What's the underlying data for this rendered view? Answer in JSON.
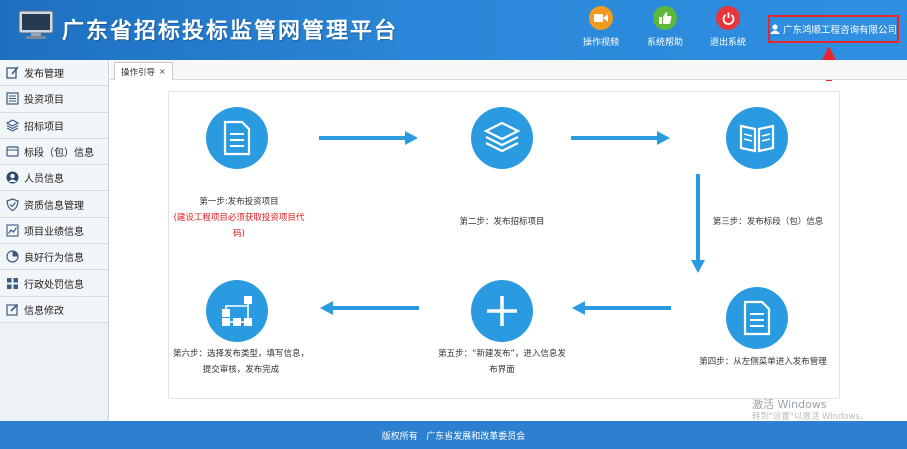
{
  "header": {
    "title": "广东省招标投标监管网管理平台",
    "buttons": [
      {
        "label": "操作视频",
        "icon": "video-icon",
        "color": "#f29a1e"
      },
      {
        "label": "系统帮助",
        "icon": "thumbs-up-icon",
        "color": "#5cb83a"
      },
      {
        "label": "退出系统",
        "icon": "power-icon",
        "color": "#e8353a"
      }
    ],
    "user": "广东鸿顺工程咨询有限公司"
  },
  "sidebar": {
    "items": [
      {
        "label": "发布管理",
        "icon": "edit-icon"
      },
      {
        "label": "投资项目",
        "icon": "list-icon"
      },
      {
        "label": "招标项目",
        "icon": "layers-icon"
      },
      {
        "label": "标段（包）信息",
        "icon": "card-icon"
      },
      {
        "label": "人员信息",
        "icon": "user-icon"
      },
      {
        "label": "资质信息管理",
        "icon": "shield-icon"
      },
      {
        "label": "项目业绩信息",
        "icon": "chart-icon"
      },
      {
        "label": "良好行为信息",
        "icon": "pie-icon"
      },
      {
        "label": "行政处罚信息",
        "icon": "grid-icon"
      },
      {
        "label": "信息修改",
        "icon": "pencil-icon"
      }
    ]
  },
  "tabs": [
    {
      "label": "操作引导",
      "close": "×"
    }
  ],
  "steps": [
    {
      "text": "第一步:发布投资项目",
      "note": "(建设工程项目必须获取投资项目代码)",
      "icon": "document-icon"
    },
    {
      "text": "第二步：发布招标项目",
      "icon": "layers-icon"
    },
    {
      "text": "第三步：发布标段（包）信息",
      "icon": "book-icon"
    },
    {
      "text": "第四步：从左侧菜单进入发布管理",
      "icon": "file-text-icon"
    },
    {
      "text": "第五步：“新建发布”，进入信息发布界面",
      "icon": "plus-icon"
    },
    {
      "text": "第六步：选择发布类型，填写信息，提交审核，发布完成",
      "icon": "flow-icon"
    }
  ],
  "colors": {
    "accent": "#2a9be0",
    "header": "#2a86d8",
    "alert": "#e8262c"
  },
  "footer": {
    "text": "版权所有   广东省发展和改革委员会"
  },
  "watermark": {
    "line1": "激活 Windows",
    "line2": "转到\"设置\"以激活 Windows。"
  }
}
